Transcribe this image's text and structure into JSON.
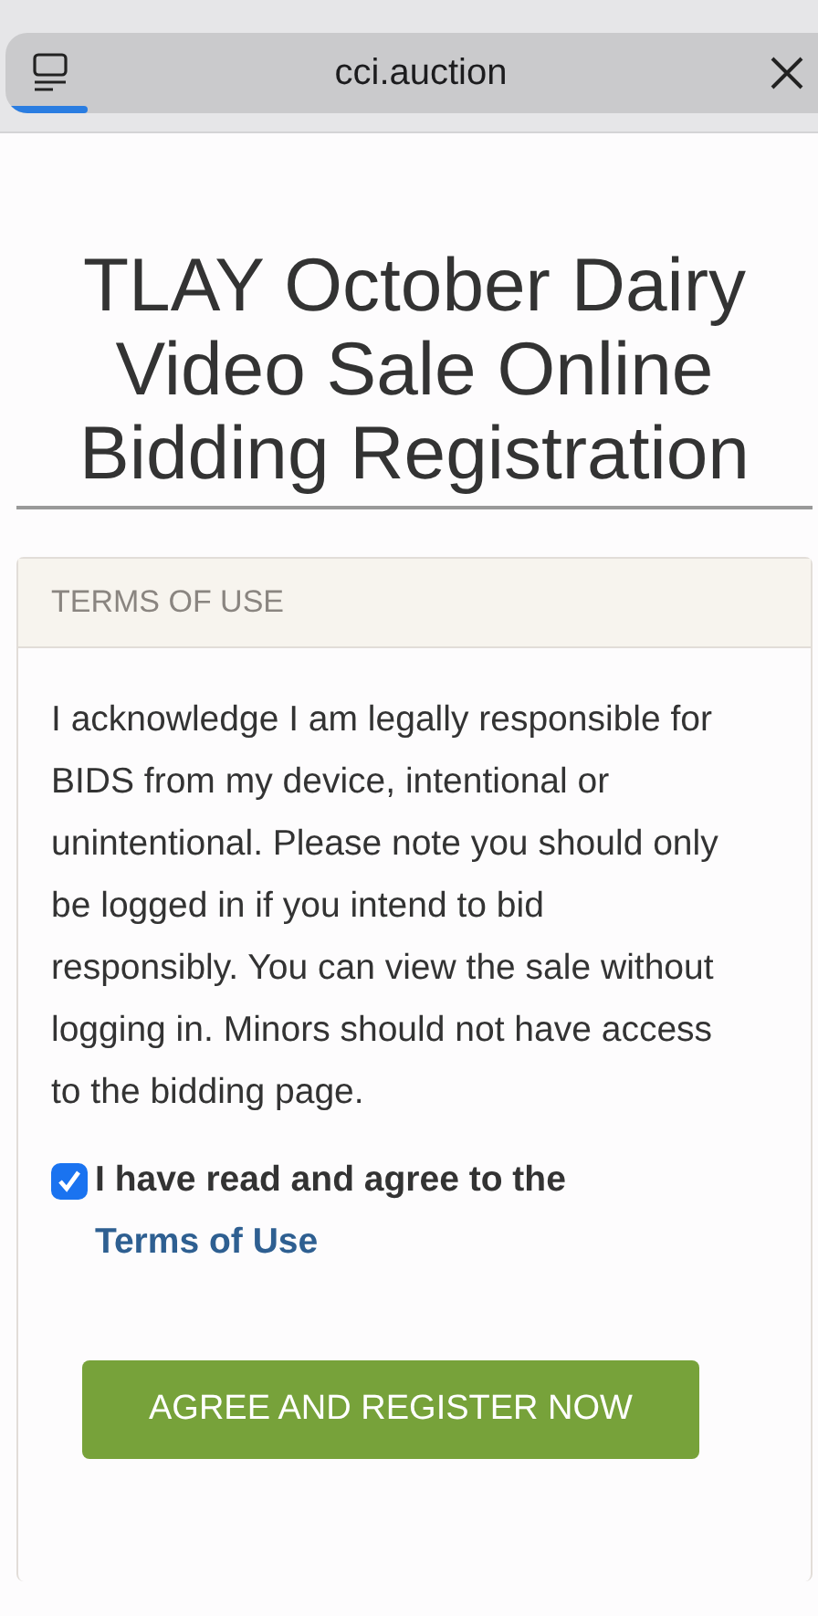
{
  "browser": {
    "address": "cci.auction",
    "progress": {
      "level": 0.1
    }
  },
  "page_title": "TLAY October Dairy Video Sale Online Bidding Registration",
  "terms_card": {
    "header": "TERMS OF USE",
    "body": "I acknowledge I am legally responsible for BIDS from my device, intentional or unintentional. Please note you should only be logged in if you intend to bid responsibly. You can view the sale without logging in. Minors should not have access to the bidding page.",
    "agreement": {
      "checked": true,
      "label": "I have read and agree to the",
      "link": "Terms of Use"
    },
    "button": "AGREE AND REGISTER NOW"
  }
}
